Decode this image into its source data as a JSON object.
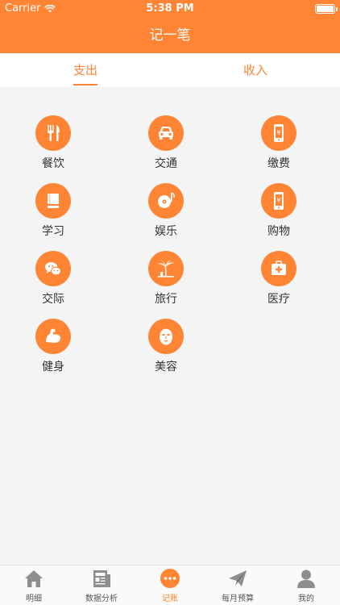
{
  "status_bar": {
    "carrier": "Carrier",
    "time": "5:38 PM"
  },
  "nav": {
    "title": "记一笔"
  },
  "tabs": [
    {
      "label": "支出",
      "active": true
    },
    {
      "label": "收入",
      "active": false
    }
  ],
  "categories": [
    {
      "label": "餐饮",
      "icon": "utensils-icon"
    },
    {
      "label": "交通",
      "icon": "car-icon"
    },
    {
      "label": "缴费",
      "icon": "phone-bill-icon"
    },
    {
      "label": "学习",
      "icon": "book-icon"
    },
    {
      "label": "娱乐",
      "icon": "music-disc-icon"
    },
    {
      "label": "购物",
      "icon": "phone-shopping-icon"
    },
    {
      "label": "交际",
      "icon": "chat-icon"
    },
    {
      "label": "旅行",
      "icon": "palm-tree-icon"
    },
    {
      "label": "医疗",
      "icon": "medical-kit-icon"
    },
    {
      "label": "健身",
      "icon": "muscle-icon"
    },
    {
      "label": "美容",
      "icon": "face-mask-icon"
    }
  ],
  "tabbar": [
    {
      "label": "明细",
      "icon": "home-icon",
      "active": false
    },
    {
      "label": "数据分析",
      "icon": "newspaper-icon",
      "active": false
    },
    {
      "label": "记账",
      "icon": "more-dots-icon",
      "active": true
    },
    {
      "label": "每月预算",
      "icon": "paper-plane-icon",
      "active": false
    },
    {
      "label": "我的",
      "icon": "user-icon",
      "active": false
    }
  ],
  "colors": {
    "accent": "#ff8433",
    "background": "#f4f4f4",
    "inactive": "#8e8e8e"
  }
}
